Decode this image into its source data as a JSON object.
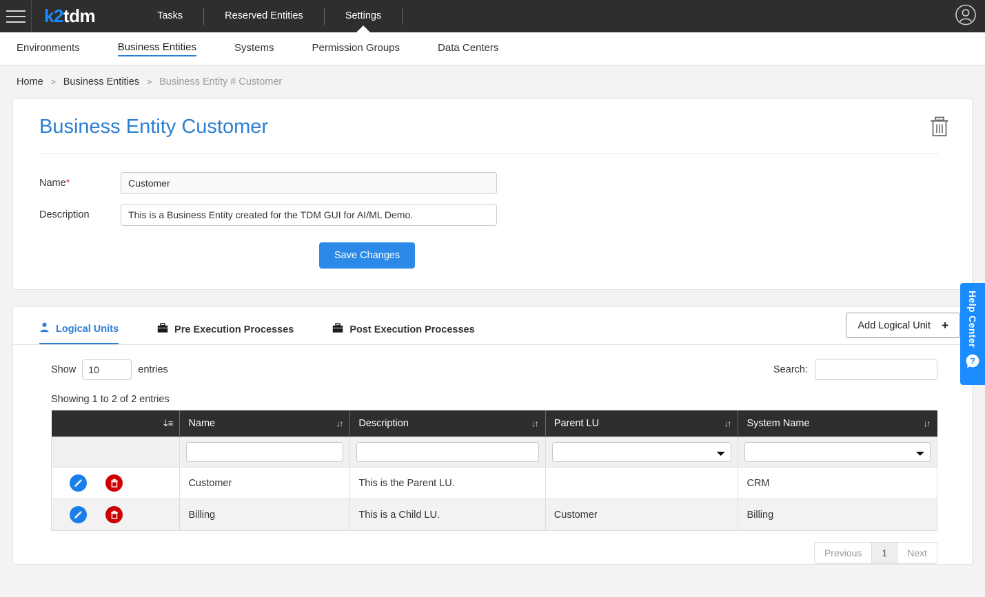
{
  "header": {
    "logo_k2": "k2",
    "logo_tdm": "tdm",
    "nav": [
      {
        "label": "Tasks",
        "active": false
      },
      {
        "label": "Reserved Entities",
        "active": false
      },
      {
        "label": "Settings",
        "active": true
      }
    ],
    "avatar_icon": "user-avatar-icon"
  },
  "subnav": {
    "items": [
      {
        "label": "Environments",
        "active": false
      },
      {
        "label": "Business Entities",
        "active": true
      },
      {
        "label": "Systems",
        "active": false
      },
      {
        "label": "Permission Groups",
        "active": false
      },
      {
        "label": "Data Centers",
        "active": false
      }
    ]
  },
  "breadcrumb": {
    "home": "Home",
    "sep": ">",
    "section": "Business Entities",
    "current": "Business Entity # Customer"
  },
  "entity": {
    "title": "Business Entity Customer",
    "delete_icon": "trash-icon",
    "name_label": "Name",
    "name_required": "*",
    "name_value": "Customer",
    "description_label": "Description",
    "description_value": "This is a Business Entity created for the TDM GUI for AI/ML Demo.",
    "save_label": "Save Changes"
  },
  "tabs": [
    {
      "label": "Logical Units",
      "icon": "person-icon",
      "active": true
    },
    {
      "label": "Pre Execution Processes",
      "icon": "briefcase-icon",
      "active": false
    },
    {
      "label": "Post Execution Processes",
      "icon": "briefcase-icon",
      "active": false
    }
  ],
  "add_button": {
    "label": "Add Logical Unit",
    "plus": "+"
  },
  "datatable": {
    "show_label": "Show",
    "show_value": "10",
    "entries_label": "entries",
    "search_label": "Search:",
    "search_value": "",
    "search_placeholder": "",
    "info": "Showing 1 to 2 of 2 entries",
    "columns": [
      {
        "label": "",
        "sort": "active-desc"
      },
      {
        "label": "Name",
        "sort": "both"
      },
      {
        "label": "Description",
        "sort": "both"
      },
      {
        "label": "Parent LU",
        "sort": "both"
      },
      {
        "label": "System Name",
        "sort": "both"
      }
    ],
    "filters": [
      {
        "type": "none",
        "value": ""
      },
      {
        "type": "text",
        "value": ""
      },
      {
        "type": "text",
        "value": ""
      },
      {
        "type": "select",
        "value": ""
      },
      {
        "type": "select",
        "value": ""
      }
    ],
    "rows": [
      {
        "edit_icon": "pencil-icon",
        "delete_icon": "trash-icon",
        "name": "Customer",
        "description": "This is the Parent LU.",
        "parent_lu": "",
        "system_name": "CRM"
      },
      {
        "edit_icon": "pencil-icon",
        "delete_icon": "trash-icon",
        "name": "Billing",
        "description": "This is a Child LU.",
        "parent_lu": "Customer",
        "system_name": "Billing"
      }
    ],
    "pagination": {
      "previous": "Previous",
      "page": "1",
      "next": "Next"
    }
  },
  "help_center": {
    "label": "Help Center",
    "icon": "question-bubble-icon"
  },
  "colors": {
    "accent": "#2b7fd4",
    "brand_blue": "#1a8cff",
    "header_dark": "#2e2e2e",
    "save_blue": "#2b8ae8",
    "delete_red": "#cc0000",
    "edit_blue": "#1a7ee8",
    "required_red": "#e03131"
  }
}
